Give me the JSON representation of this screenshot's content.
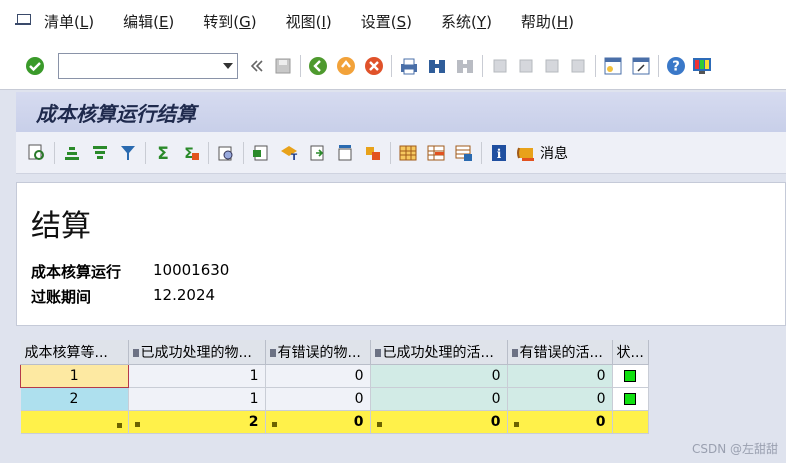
{
  "menu": [
    {
      "label": "清单(",
      "key": "L",
      "tail": ")"
    },
    {
      "label": "编辑(",
      "key": "E",
      "tail": ")"
    },
    {
      "label": "转到(",
      "key": "G",
      "tail": ")"
    },
    {
      "label": "视图(",
      "key": "I",
      "tail": ")"
    },
    {
      "label": "设置(",
      "key": "S",
      "tail": ")"
    },
    {
      "label": "系统(",
      "key": "Y",
      "tail": ")"
    },
    {
      "label": "帮助(",
      "key": "H",
      "tail": ")"
    }
  ],
  "command_field": {
    "value": ""
  },
  "title": "成本核算运行结算",
  "app_toolbar": {
    "message_label": "消息"
  },
  "content": {
    "heading": "结算",
    "fields": [
      {
        "label": "成本核算运行",
        "value": "10001630"
      },
      {
        "label": "过账期间",
        "value": "12.2024"
      }
    ]
  },
  "table": {
    "columns": [
      "成本核算等...",
      "已成功处理的物...",
      "有错误的物...",
      "已成功处理的活...",
      "有错误的活...",
      "状..."
    ],
    "rows": [
      {
        "level": "1",
        "ok_mat": "1",
        "err_mat": "0",
        "ok_act": "0",
        "err_act": "0"
      },
      {
        "level": "2",
        "ok_mat": "1",
        "err_mat": "0",
        "ok_act": "0",
        "err_act": "0"
      }
    ],
    "totals": {
      "ok_mat": "2",
      "err_mat": "0",
      "ok_act": "0",
      "err_act": "0"
    }
  },
  "watermark": "CSDN @左甜甜",
  "colors": {
    "title_bg": "#c8cfe9",
    "total_row": "#fff14a",
    "status_green": "#10e010"
  }
}
